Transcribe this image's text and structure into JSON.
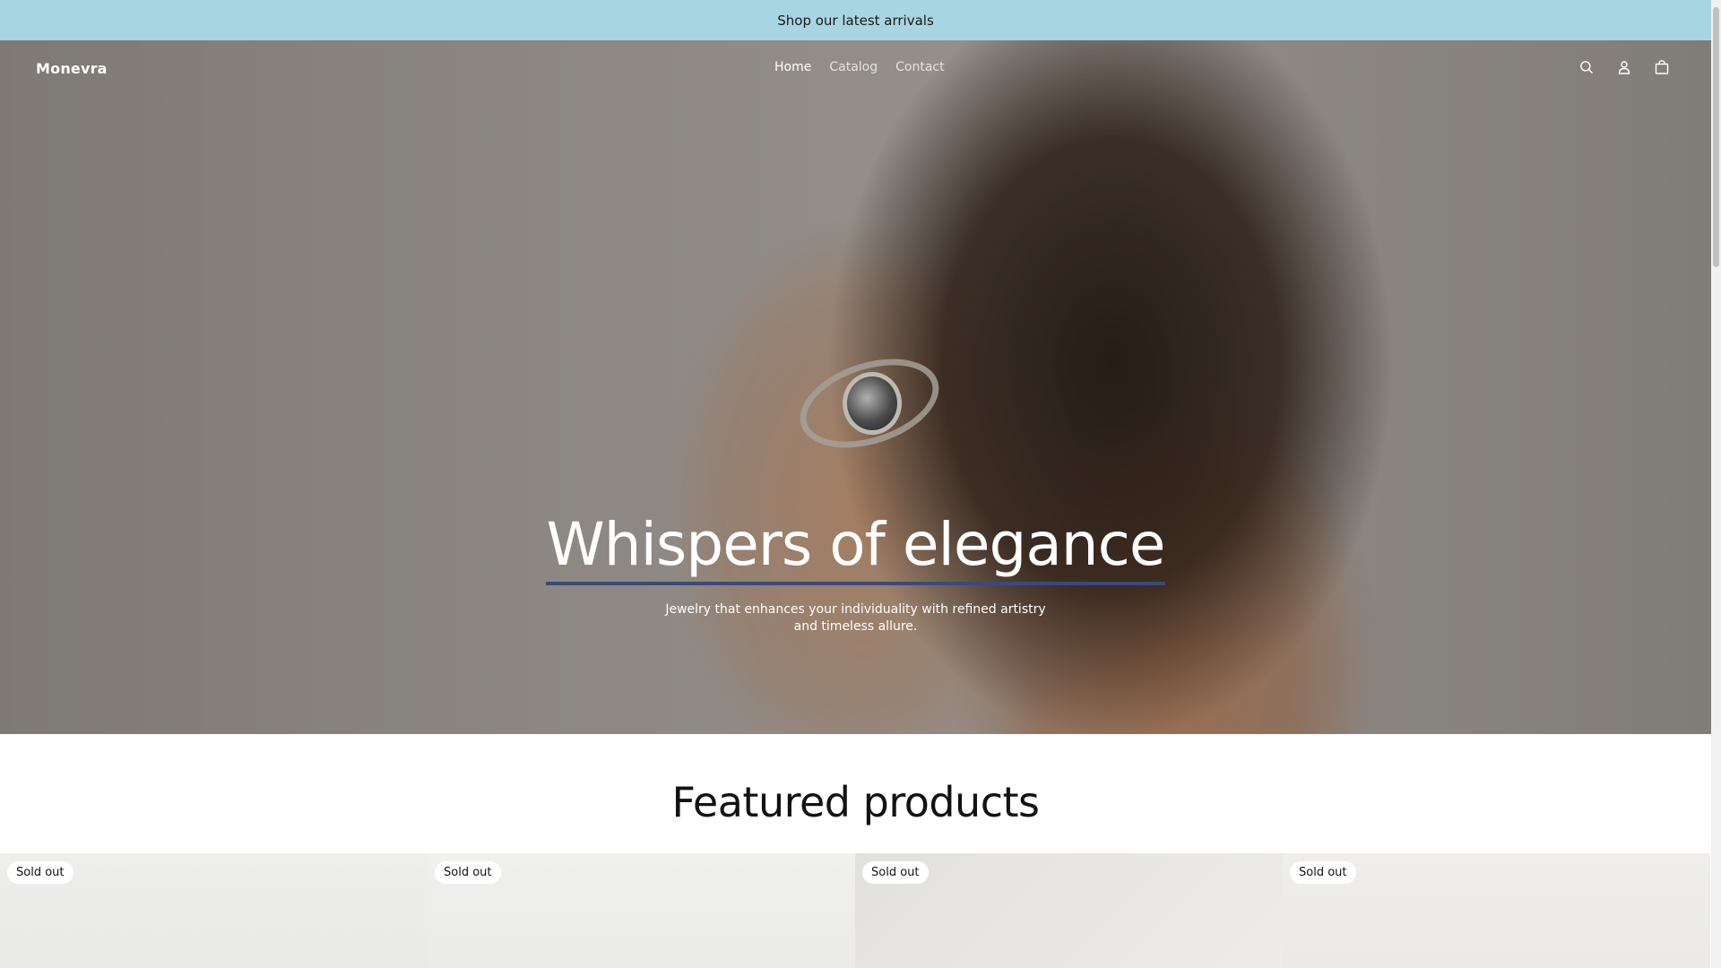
{
  "announcement": {
    "text": "Shop our latest arrivals"
  },
  "header": {
    "logo": "Monevra",
    "nav": [
      {
        "label": "Home",
        "active": true
      },
      {
        "label": "Catalog",
        "active": false
      },
      {
        "label": "Contact",
        "active": false
      }
    ],
    "icons": [
      "search-icon",
      "account-icon",
      "cart-icon"
    ]
  },
  "hero": {
    "title": "Whispers of elegance",
    "subtitle": "Jewelry that enhances your individuality with refined artistry and timeless allure."
  },
  "featured": {
    "title": "Featured products",
    "products": [
      {
        "badge": "Sold out"
      },
      {
        "badge": "Sold out"
      },
      {
        "badge": "Sold out"
      },
      {
        "badge": "Sold out"
      }
    ]
  },
  "colors": {
    "announcement_bg": "#a8d5e2",
    "title_underline": "#3a4a7a",
    "text_dark": "#121212"
  }
}
